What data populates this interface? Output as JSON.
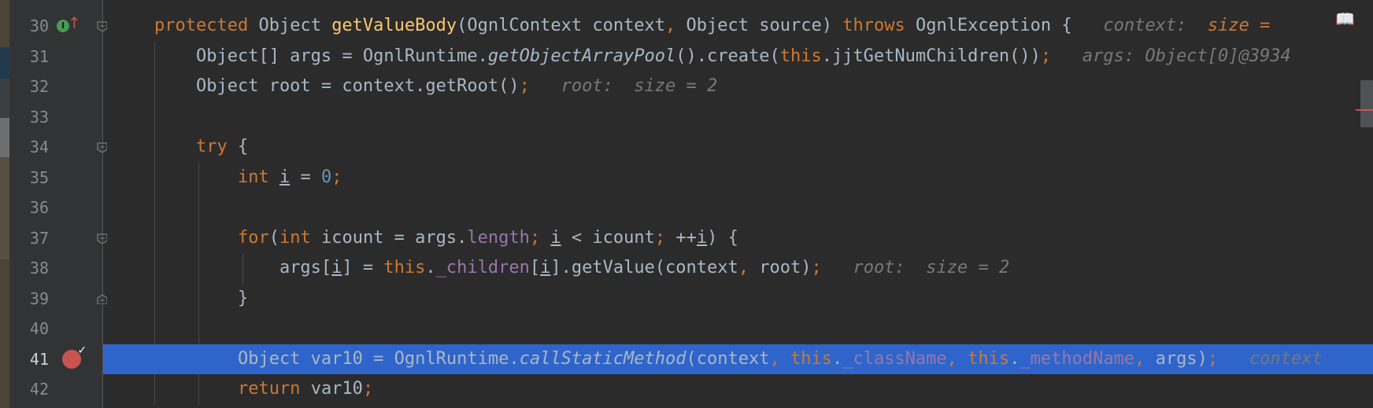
{
  "editor": {
    "lines": [
      {
        "num": "30",
        "tokens": [
          {
            "t": "protected",
            "c": "kw"
          },
          {
            "t": " Object "
          },
          {
            "t": "getValueBody",
            "c": "fn"
          },
          {
            "t": "(OgnlContext context"
          },
          {
            "t": ",",
            "c": "kw"
          },
          {
            "t": " Object source) "
          },
          {
            "t": "throws",
            "c": "kw"
          },
          {
            "t": " OgnlException {   "
          },
          {
            "t": "context:  ",
            "c": "hint"
          },
          {
            "t": "size = ",
            "c": "hintval"
          }
        ]
      },
      {
        "num": "31",
        "tokens": [
          {
            "t": "    Object[] args = OgnlRuntime."
          },
          {
            "t": "getObjectArrayPool",
            "c": "it"
          },
          {
            "t": "().create("
          },
          {
            "t": "this",
            "c": "kw"
          },
          {
            "t": ".jjtGetNumChildren())"
          },
          {
            "t": ";",
            "c": "kw"
          },
          {
            "t": "   "
          },
          {
            "t": "args: Object[0]@3934",
            "c": "hint"
          }
        ]
      },
      {
        "num": "32",
        "tokens": [
          {
            "t": "    Object root = context.getRoot()"
          },
          {
            "t": ";",
            "c": "kw"
          },
          {
            "t": "   "
          },
          {
            "t": "root:  size = 2",
            "c": "hint"
          }
        ]
      },
      {
        "num": "33",
        "tokens": []
      },
      {
        "num": "34",
        "tokens": [
          {
            "t": "    "
          },
          {
            "t": "try",
            "c": "kw"
          },
          {
            "t": " {"
          }
        ]
      },
      {
        "num": "35",
        "tokens": [
          {
            "t": "        "
          },
          {
            "t": "int",
            "c": "kw"
          },
          {
            "t": " "
          },
          {
            "t": "i",
            "c": "ul"
          },
          {
            "t": " = "
          },
          {
            "t": "0",
            "c": "num"
          },
          {
            "t": ";",
            "c": "kw"
          }
        ]
      },
      {
        "num": "36",
        "tokens": []
      },
      {
        "num": "37",
        "tokens": [
          {
            "t": "        "
          },
          {
            "t": "for",
            "c": "kw"
          },
          {
            "t": "("
          },
          {
            "t": "int",
            "c": "kw"
          },
          {
            "t": " icount = args."
          },
          {
            "t": "length",
            "c": "fld"
          },
          {
            "t": ";",
            "c": "kw"
          },
          {
            "t": " "
          },
          {
            "t": "i",
            "c": "ul"
          },
          {
            "t": " < icount"
          },
          {
            "t": ";",
            "c": "kw"
          },
          {
            "t": " ++"
          },
          {
            "t": "i",
            "c": "ul"
          },
          {
            "t": ") {"
          }
        ]
      },
      {
        "num": "38",
        "tokens": [
          {
            "t": "            args["
          },
          {
            "t": "i",
            "c": "ul"
          },
          {
            "t": "] = "
          },
          {
            "t": "this",
            "c": "kw"
          },
          {
            "t": "."
          },
          {
            "t": "_children",
            "c": "fld"
          },
          {
            "t": "["
          },
          {
            "t": "i",
            "c": "ul"
          },
          {
            "t": "].getValue(context"
          },
          {
            "t": ",",
            "c": "kw"
          },
          {
            "t": " root)"
          },
          {
            "t": ";",
            "c": "kw"
          },
          {
            "t": "   "
          },
          {
            "t": "root:  size = 2",
            "c": "hint"
          }
        ]
      },
      {
        "num": "39",
        "tokens": [
          {
            "t": "        }"
          }
        ]
      },
      {
        "num": "40",
        "tokens": []
      },
      {
        "num": "41",
        "current": true,
        "tokens": [
          {
            "t": "        Object var10 = OgnlRuntime."
          },
          {
            "t": "callStaticMethod",
            "c": "it"
          },
          {
            "t": "(context"
          },
          {
            "t": ",",
            "c": "kw"
          },
          {
            "t": " "
          },
          {
            "t": "this",
            "c": "kw"
          },
          {
            "t": "."
          },
          {
            "t": "_className",
            "c": "fld"
          },
          {
            "t": ",",
            "c": "kw"
          },
          {
            "t": " "
          },
          {
            "t": "this",
            "c": "kw"
          },
          {
            "t": "."
          },
          {
            "t": "_methodName",
            "c": "fld"
          },
          {
            "t": ",",
            "c": "kw"
          },
          {
            "t": " args)"
          },
          {
            "t": ";",
            "c": "kw"
          },
          {
            "t": "   "
          },
          {
            "t": "context",
            "c": "hint"
          }
        ]
      },
      {
        "num": "42",
        "tokens": [
          {
            "t": "        "
          },
          {
            "t": "return",
            "c": "kw"
          },
          {
            "t": " var10"
          },
          {
            "t": ";",
            "c": "kw"
          }
        ]
      }
    ],
    "gutter_icons": {
      "30": "implementing-method-icon",
      "41": "breakpoint-icon"
    },
    "colors": {
      "background": "#2b2b2b",
      "gutter": "#313335",
      "keyword": "#cc7832",
      "function": "#ffc66d",
      "number": "#6897bb",
      "field": "#9876aa",
      "hint": "#787878",
      "current_line": "#2f65ca",
      "breakpoint": "#c75450"
    }
  },
  "top_right": {
    "reader_mode_icon": "book-icon"
  }
}
